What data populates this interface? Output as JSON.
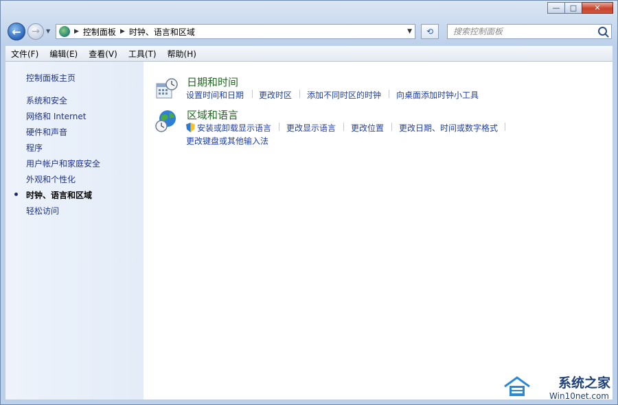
{
  "window": {
    "controls": {
      "minimize": "—",
      "restore": "□",
      "close": "✕"
    }
  },
  "nav": {
    "back_icon": "←",
    "forward_icon": "→",
    "breadcrumb": [
      "控制面板",
      "时钟、语言和区域"
    ],
    "search_placeholder": "搜索控制面板"
  },
  "menubar": {
    "items": [
      "文件(F)",
      "编辑(E)",
      "查看(V)",
      "工具(T)",
      "帮助(H)"
    ]
  },
  "sidebar": {
    "home": "控制面板主页",
    "items": [
      "系统和安全",
      "网络和 Internet",
      "硬件和声音",
      "程序",
      "用户帐户和家庭安全",
      "外观和个性化",
      "时钟、语言和区域",
      "轻松访问"
    ],
    "active_index": 6
  },
  "categories": [
    {
      "title": "日期和时间",
      "icon": "calendar-clock-icon",
      "tasks": [
        "设置时间和日期",
        "更改时区",
        "添加不同时区的时钟",
        "向桌面添加时钟小工具"
      ]
    },
    {
      "title": "区域和语言",
      "icon": "globe-clock-icon",
      "tasks": [
        "安装或卸载显示语言",
        "更改显示语言",
        "更改位置",
        "更改日期、时间或数字格式",
        "更改键盘或其他输入法"
      ]
    }
  ],
  "watermark": {
    "title": "系统之家",
    "site": "Win10net.com"
  },
  "colors": {
    "link": "#1e3fa8",
    "category_title": "#1e6a1e",
    "sidebar_link": "#1e3287"
  }
}
